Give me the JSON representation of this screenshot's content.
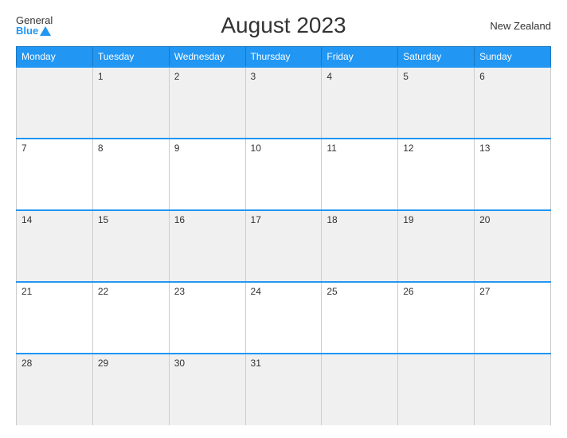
{
  "header": {
    "logo_general": "General",
    "logo_blue": "Blue",
    "title": "August 2023",
    "country": "New Zealand"
  },
  "calendar": {
    "weekdays": [
      "Monday",
      "Tuesday",
      "Wednesday",
      "Thursday",
      "Friday",
      "Saturday",
      "Sunday"
    ],
    "weeks": [
      [
        {
          "day": "",
          "empty": true
        },
        {
          "day": "1"
        },
        {
          "day": "2"
        },
        {
          "day": "3"
        },
        {
          "day": "4"
        },
        {
          "day": "5"
        },
        {
          "day": "6"
        }
      ],
      [
        {
          "day": "7"
        },
        {
          "day": "8"
        },
        {
          "day": "9"
        },
        {
          "day": "10"
        },
        {
          "day": "11"
        },
        {
          "day": "12"
        },
        {
          "day": "13"
        }
      ],
      [
        {
          "day": "14"
        },
        {
          "day": "15"
        },
        {
          "day": "16"
        },
        {
          "day": "17"
        },
        {
          "day": "18"
        },
        {
          "day": "19"
        },
        {
          "day": "20"
        }
      ],
      [
        {
          "day": "21"
        },
        {
          "day": "22"
        },
        {
          "day": "23"
        },
        {
          "day": "24"
        },
        {
          "day": "25"
        },
        {
          "day": "26"
        },
        {
          "day": "27"
        }
      ],
      [
        {
          "day": "28"
        },
        {
          "day": "29"
        },
        {
          "day": "30"
        },
        {
          "day": "31"
        },
        {
          "day": "",
          "empty": true
        },
        {
          "day": "",
          "empty": true
        },
        {
          "day": "",
          "empty": true
        }
      ]
    ]
  }
}
